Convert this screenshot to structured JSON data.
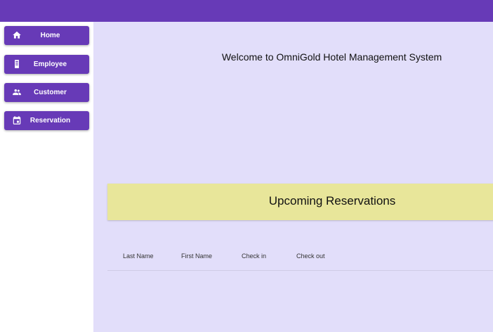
{
  "sidebar": {
    "items": [
      {
        "label": "Home",
        "icon": "home-icon"
      },
      {
        "label": "Employee",
        "icon": "badge-icon"
      },
      {
        "label": "Customer",
        "icon": "people-icon"
      },
      {
        "label": "Reservation",
        "icon": "calendar-icon"
      }
    ]
  },
  "main": {
    "welcome": "Welcome to OmniGold Hotel Management System",
    "upcoming_title": "Upcoming Reservations",
    "table": {
      "columns": [
        "Last Name",
        "First Name",
        "Check in",
        "Check out"
      ],
      "rows": []
    }
  },
  "colors": {
    "primary": "#673ab7",
    "main_background": "#e2defa",
    "banner": "#e8e69a"
  }
}
